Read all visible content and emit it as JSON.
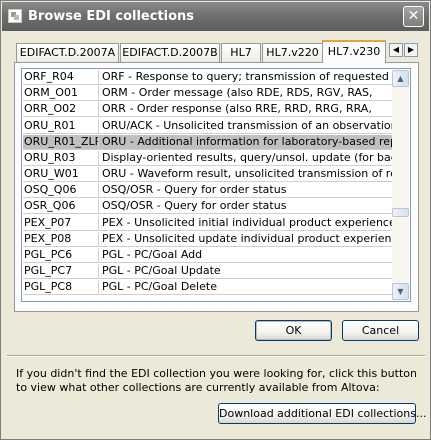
{
  "window": {
    "title": "Browse EDI collections",
    "close_symbol": "✕"
  },
  "tabs": [
    {
      "label": "EDIFACT.D.2007A",
      "active": false
    },
    {
      "label": "EDIFACT.D.2007B",
      "active": false
    },
    {
      "label": "HL7",
      "active": false
    },
    {
      "label": "HL7.v220",
      "active": false
    },
    {
      "label": "HL7.v230",
      "active": true
    }
  ],
  "tab_scroll": {
    "left": "◀",
    "right": "▶"
  },
  "collections": [
    {
      "code": "ORF_R04",
      "description": "ORF - Response to query; transmission of requested observ"
    },
    {
      "code": "ORM_O01",
      "description": "ORM - Order message (also RDE, RDS, RGV, RAS,"
    },
    {
      "code": "ORR_O02",
      "description": "ORR - Order response (also RRE, RRD, RRG, RRA,"
    },
    {
      "code": "ORU_R01",
      "description": "ORU/ACK - Unsolicited transmission of an observation"
    },
    {
      "code": "ORU_R01_ZLR",
      "description": "ORU - Additional information for laboratory-based reporting",
      "selected": true
    },
    {
      "code": "ORU_R03",
      "description": "Display-oriented results, query/unsol. update (for backward"
    },
    {
      "code": "ORU_W01",
      "description": "ORU - Waveform result, unsolicited transmission of requeste"
    },
    {
      "code": "OSQ_Q06",
      "description": "OSQ/OSR - Query for order status"
    },
    {
      "code": "OSR_Q06",
      "description": "OSQ/OSR - Query for order status"
    },
    {
      "code": "PEX_P07",
      "description": "PEX - Unsolicited initial individual product experience report"
    },
    {
      "code": "PEX_P08",
      "description": "PEX - Unsolicited update individual product experience report"
    },
    {
      "code": "PGL_PC6",
      "description": "PGL - PC/Goal Add"
    },
    {
      "code": "PGL_PC7",
      "description": "PGL - PC/Goal Update"
    },
    {
      "code": "PGL_PC8",
      "description": "PGL - PC/Goal Delete"
    }
  ],
  "scrollbar": {
    "up": "▲",
    "down": "▼"
  },
  "buttons": {
    "ok": "OK",
    "cancel": "Cancel",
    "download": "Download additional EDI collections..."
  },
  "info_text": "If you didn't find the EDI collection you were looking for, click this button to view what other collections are currently available from Altova:"
}
